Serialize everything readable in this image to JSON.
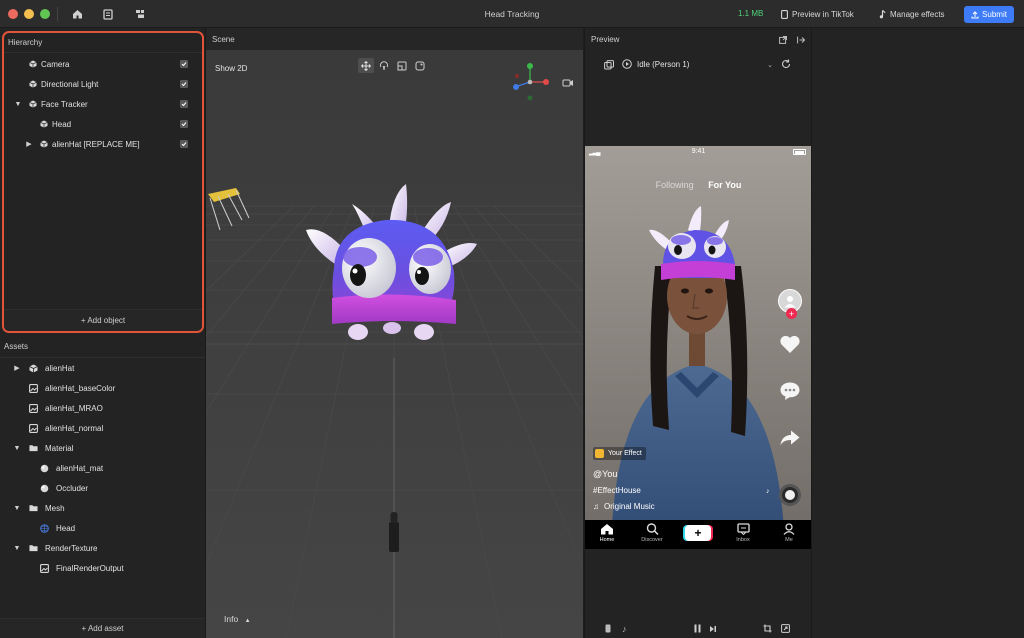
{
  "window": {
    "title": "Head Tracking",
    "project_size": "1.1 MB",
    "preview_button": "Preview in TikTok",
    "manage_effects": "Manage effects",
    "submit": "Submit"
  },
  "hierarchy": {
    "header": "Hierarchy",
    "items": [
      {
        "label": "Camera",
        "checked": true
      },
      {
        "label": "Directional Light",
        "checked": true
      },
      {
        "label": "Face Tracker",
        "checked": true
      },
      {
        "label": "Head",
        "checked": true
      },
      {
        "label": "alienHat [REPLACE ME]",
        "checked": true
      }
    ],
    "add_object": "+ Add object"
  },
  "assets": {
    "header": "Assets",
    "items": [
      {
        "label": "alienHat"
      },
      {
        "label": "alienHat_baseColor"
      },
      {
        "label": "alienHat_MRAO"
      },
      {
        "label": "alienHat_normal"
      },
      {
        "label": "Material"
      },
      {
        "label": "alienHat_mat"
      },
      {
        "label": "Occluder"
      },
      {
        "label": "Mesh"
      },
      {
        "label": "Head"
      },
      {
        "label": "RenderTexture"
      },
      {
        "label": "FinalRenderOutput"
      }
    ],
    "add_asset": "+ Add asset"
  },
  "scene": {
    "header": "Scene",
    "show_2d": "Show 2D",
    "info": "Info"
  },
  "preview": {
    "header": "Preview",
    "selected_video": "Idle (Person 1)",
    "phone": {
      "time": "9:41",
      "tab_following": "Following",
      "tab_for_you": "For You",
      "effect_label": "Your Effect",
      "handle": "@You",
      "hashtag": "#EffectHouse",
      "music": "Original Music",
      "nav": [
        "Home",
        "Discover",
        "Inbox",
        "Me"
      ]
    }
  },
  "colors": {
    "accent": "#3d7bf7",
    "highlight_border": "#e0553a",
    "size_green": "#4fd17a",
    "hat_purple": "#6a4fe0",
    "hat_band": "#c43fd6"
  }
}
